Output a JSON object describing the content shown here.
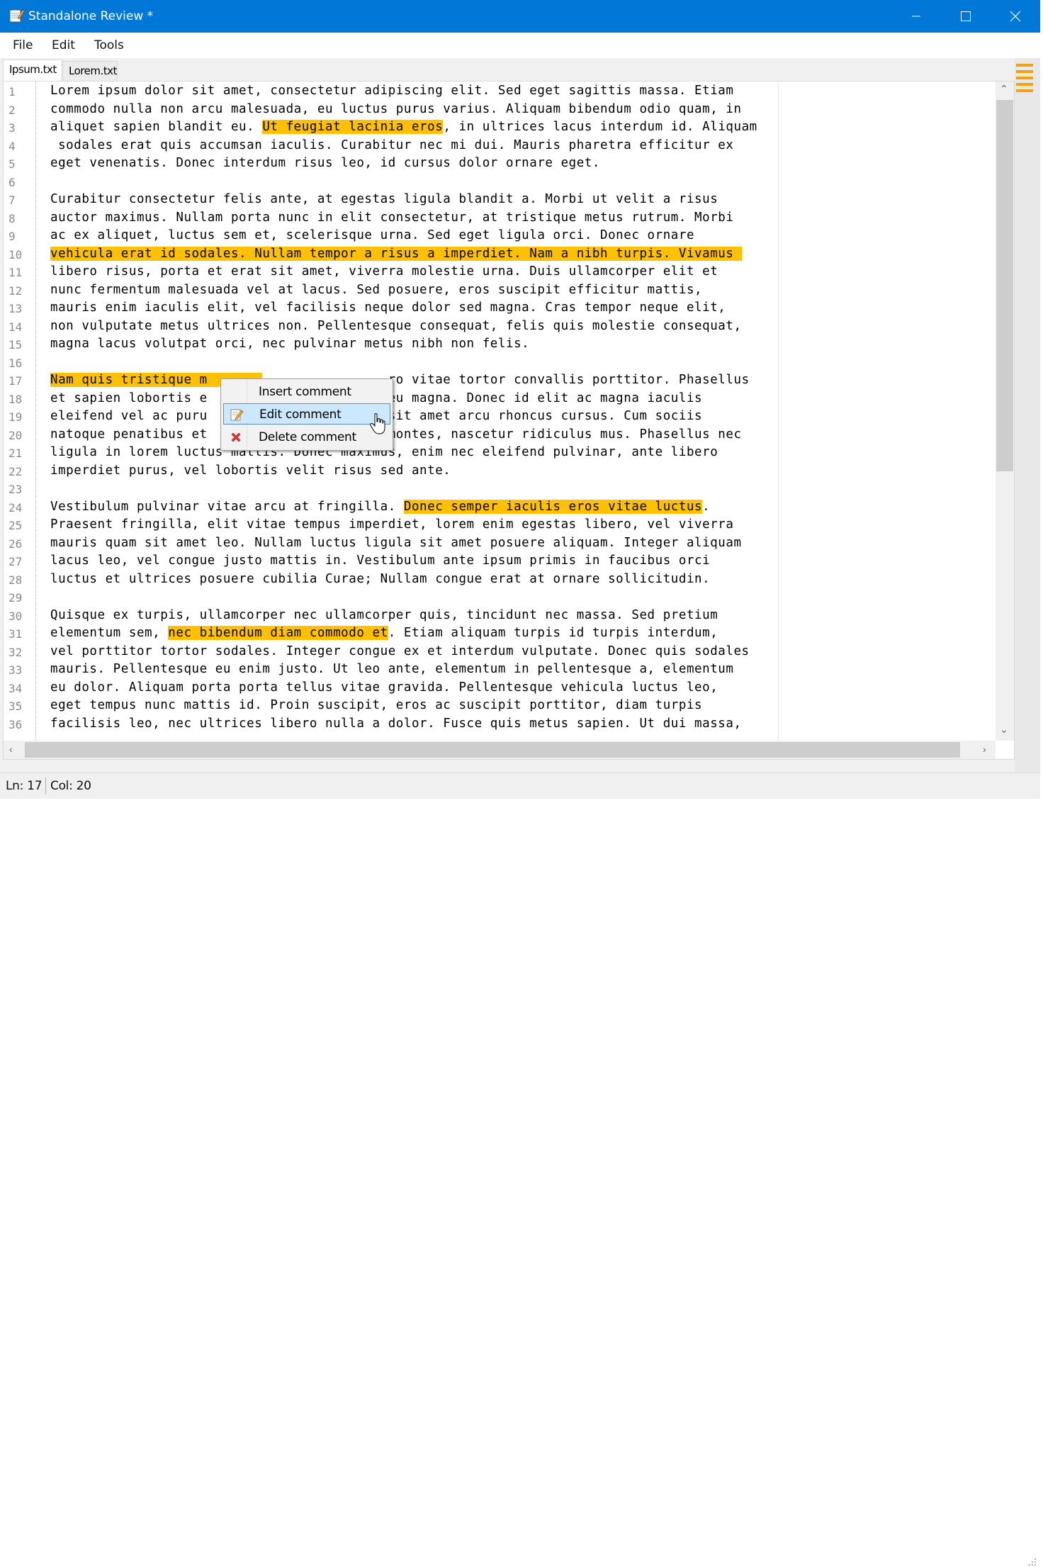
{
  "window": {
    "title": "Standalone Review *",
    "icons": {
      "app": "notepad-icon",
      "minimize": "minimize-icon",
      "maximize": "maximize-icon",
      "close": "close-icon"
    }
  },
  "menubar": {
    "items": [
      "File",
      "Edit",
      "Tools"
    ]
  },
  "tabs": [
    {
      "label": "Ipsum.txt",
      "active": true
    },
    {
      "label": "Lorem.txt",
      "active": false
    }
  ],
  "editor": {
    "highlight_color": "#ffc000",
    "lines": [
      [
        {
          "t": "Lorem ipsum dolor sit amet, consectetur adipiscing elit. Sed eget sagittis massa. Etiam"
        }
      ],
      [
        {
          "t": "commodo nulla non arcu malesuada, eu luctus purus varius. Aliquam bibendum odio quam, in"
        }
      ],
      [
        {
          "t": "aliquet sapien blandit eu. "
        },
        {
          "t": "Ut feugiat lacinia eros",
          "h": true
        },
        {
          "t": ", in ultrices lacus interdum id. Aliquam"
        }
      ],
      [
        {
          "t": " sodales erat quis accumsan iaculis. Curabitur nec mi dui. Mauris pharetra efficitur ex"
        }
      ],
      [
        {
          "t": "eget venenatis. Donec interdum risus leo, id cursus dolor ornare eget."
        }
      ],
      [
        {
          "t": ""
        }
      ],
      [
        {
          "t": "Curabitur consectetur felis ante, at egestas ligula blandit a. Morbi ut velit a risus"
        }
      ],
      [
        {
          "t": "auctor maximus. Nullam porta nunc in elit consectetur, at tristique metus rutrum. Morbi"
        }
      ],
      [
        {
          "t": "ac ex aliquet, luctus sem et, scelerisque urna. Sed eget ligula orci. Donec ornare"
        }
      ],
      [
        {
          "t": "vehicula erat id sodales. Nullam tempor a risus a imperdiet. Nam a nibh turpis. Vivamus ",
          "h": true
        }
      ],
      [
        {
          "t": "libero risus, porta et erat sit amet, viverra molestie urna. Duis ullamcorper elit et"
        }
      ],
      [
        {
          "t": "nunc fermentum malesuada vel at lacus. Sed posuere, eros suscipit efficitur mattis,"
        }
      ],
      [
        {
          "t": "mauris enim iaculis elit, vel facilisis neque dolor sed magna. Cras tempor neque elit,"
        }
      ],
      [
        {
          "t": "non vulputate metus ultrices non. Pellentesque consequat, felis quis molestie consequat,"
        }
      ],
      [
        {
          "t": "magna lacus volutpat orci, nec pulvinar metus nibh non felis."
        }
      ],
      [
        {
          "t": ""
        }
      ],
      [
        {
          "t": "Nam quis tristique m",
          "h": true
        },
        {
          "t": "       ",
          "h": true
        },
        {
          "t": "                ro vitae tortor convallis porttitor. Phasellus"
        }
      ],
      [
        {
          "t": "et sapien lobortis e                    eu eu magna. Donec id elit ac magna iaculis"
        }
      ],
      [
        {
          "t": "eleifend vel ac puru                    cu sit amet arcu rhoncus cursus. Cum sociis"
        }
      ],
      [
        {
          "t": "natoque penatibus et                    nt montes, nascetur ridiculus mus. Phasellus nec"
        }
      ],
      [
        {
          "t": "ligula in lorem luctus mattis. Donec maximus, enim nec eleifend pulvinar, ante libero"
        }
      ],
      [
        {
          "t": "imperdiet purus, vel lobortis velit risus sed ante."
        }
      ],
      [
        {
          "t": ""
        }
      ],
      [
        {
          "t": "Vestibulum pulvinar vitae arcu at fringilla. "
        },
        {
          "t": "Donec semper iaculis eros vitae luctus",
          "h": true
        },
        {
          "t": "."
        }
      ],
      [
        {
          "t": "Praesent fringilla, elit vitae tempus imperdiet, lorem enim egestas libero, vel viverra"
        }
      ],
      [
        {
          "t": "mauris quam sit amet leo. Nullam luctus ligula sit amet posuere aliquam. Integer aliquam"
        }
      ],
      [
        {
          "t": "lacus leo, vel congue justo mattis in. Vestibulum ante ipsum primis in faucibus orci"
        }
      ],
      [
        {
          "t": "luctus et ultrices posuere cubilia Curae; Nullam congue erat at ornare sollicitudin."
        }
      ],
      [
        {
          "t": ""
        }
      ],
      [
        {
          "t": "Quisque ex turpis, ullamcorper nec ullamcorper quis, tincidunt nec massa. Sed pretium"
        }
      ],
      [
        {
          "t": "elementum sem, "
        },
        {
          "t": "nec bibendum diam commodo et",
          "h": true
        },
        {
          "t": ". Etiam aliquam turpis id turpis interdum,"
        }
      ],
      [
        {
          "t": "vel porttitor tortor sodales. Integer congue ex et interdum vulputate. Donec quis sodales"
        }
      ],
      [
        {
          "t": "mauris. Pellentesque eu enim justo. Ut leo ante, elementum in pellentesque a, elementum"
        }
      ],
      [
        {
          "t": "eu dolor. Aliquam porta porta tellus vitae gravida. Pellentesque vehicula luctus leo,"
        }
      ],
      [
        {
          "t": "eget tempus nunc mattis id. Proin suscipit, eros ac suscipit porttitor, diam turpis"
        }
      ],
      [
        {
          "t": "facilisis leo, nec ultrices libero nulla a dolor. Fusce quis metus sapien. Ut dui massa,"
        }
      ]
    ]
  },
  "context_menu": {
    "items": [
      {
        "label": "Insert comment",
        "icon": ""
      },
      {
        "label": "Edit comment",
        "icon": "edit-note-icon",
        "hovered": true
      },
      {
        "label": "Delete comment",
        "icon": "red-x-icon"
      }
    ]
  },
  "statusbar": {
    "line": "Ln: 17",
    "col": "Col: 20"
  }
}
